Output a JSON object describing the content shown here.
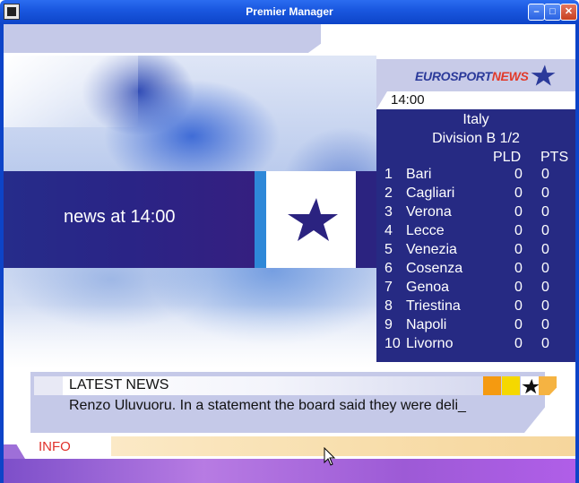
{
  "window": {
    "title": "Premier Manager",
    "buttons": {
      "minimize": "–",
      "maximize": "□",
      "close": "✕"
    }
  },
  "banner": {
    "headline": "news at 14:00",
    "icon": "star-icon"
  },
  "eurosport": {
    "logo_part1": "EUROSPORT",
    "logo_part2": "NEWS",
    "time": "14:00",
    "country": "Italy",
    "division": "Division B  1/2",
    "columns": {
      "pld": "PLD",
      "pts": "PTS"
    },
    "table": [
      {
        "pos": "1",
        "team": "Bari",
        "pld": "0",
        "pts": "0"
      },
      {
        "pos": "2",
        "team": "Cagliari",
        "pld": "0",
        "pts": "0"
      },
      {
        "pos": "3",
        "team": "Verona",
        "pld": "0",
        "pts": "0"
      },
      {
        "pos": "4",
        "team": "Lecce",
        "pld": "0",
        "pts": "0"
      },
      {
        "pos": "5",
        "team": "Venezia",
        "pld": "0",
        "pts": "0"
      },
      {
        "pos": "6",
        "team": "Cosenza",
        "pld": "0",
        "pts": "0"
      },
      {
        "pos": "7",
        "team": "Genoa",
        "pld": "0",
        "pts": "0"
      },
      {
        "pos": "8",
        "team": "Triestina",
        "pld": "0",
        "pts": "0"
      },
      {
        "pos": "9",
        "team": "Napoli",
        "pld": "0",
        "pts": "0"
      },
      {
        "pos": "10",
        "team": "Livorno",
        "pld": "0",
        "pts": "0"
      }
    ]
  },
  "latest_news": {
    "title": "LATEST NEWS",
    "body": "Renzo Uluvuoru. In a statement the board said they were deli_"
  },
  "info_bar": {
    "label": "INFO",
    "ticker": ""
  },
  "colors": {
    "panel_blue": "#262a83",
    "lavender": "#c5c9e8",
    "info_red": "#e0302a",
    "accent_orange": "#f59a10",
    "accent_yellow": "#f5d800"
  }
}
